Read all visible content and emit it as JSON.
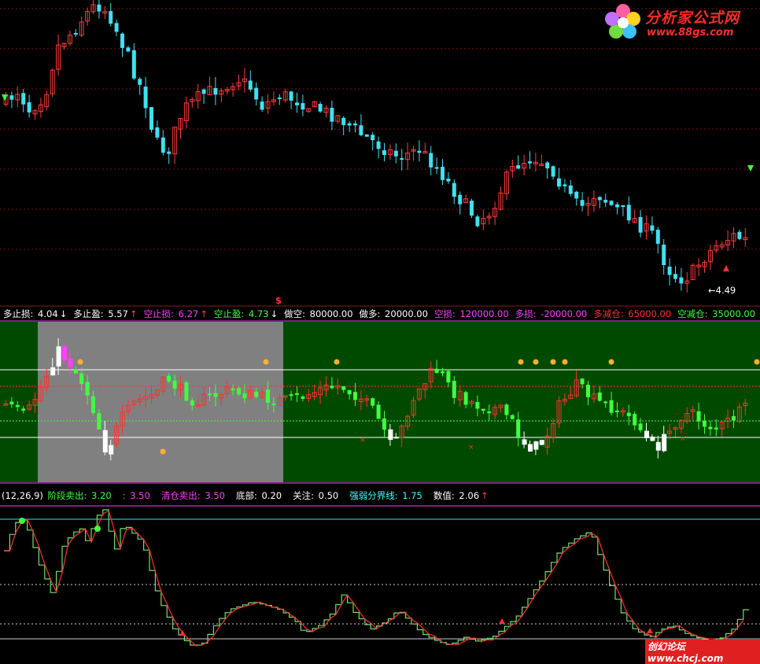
{
  "logo": {
    "title": "分析家公式网",
    "url": "www.88gs.com"
  },
  "price_panel": {
    "price_low_label": "4.49",
    "dollar_mark": "$",
    "colors": {
      "up": "#ff3b3b",
      "down": "#40e0f0",
      "grid": "#7a1010"
    }
  },
  "header1": {
    "items": [
      {
        "label": "多止损:",
        "value": "4.04",
        "color": "#ffffff",
        "arrow": "↓"
      },
      {
        "label": "多止盈:",
        "value": "5.57",
        "color": "#ffffff",
        "arrow": "↑"
      },
      {
        "label": "空止损:",
        "value": "6.27",
        "color": "#ff40ff",
        "arrow": "↑"
      },
      {
        "label": "空止盈:",
        "value": "4.73",
        "color": "#40ff40",
        "arrow": "↓"
      },
      {
        "label": "做空:",
        "value": "80000.00",
        "color": "#ffffff",
        "arrow": ""
      },
      {
        "label": "做多:",
        "value": "20000.00",
        "color": "#ffffff",
        "arrow": ""
      },
      {
        "label": "空损:",
        "value": "120000.00",
        "color": "#ff40ff",
        "arrow": ""
      },
      {
        "label": "多损:",
        "value": "-20000.00",
        "color": "#ff40ff",
        "arrow": ""
      },
      {
        "label": "多减仓:",
        "value": "65000.00",
        "color": "#ff3030",
        "arrow": ""
      },
      {
        "label": "空减仓:",
        "value": "35000.00",
        "color": "#40ff40",
        "arrow": ""
      }
    ]
  },
  "header2": {
    "params": "(12,26,9)",
    "items": [
      {
        "label": "阶段卖出:",
        "value": "3.20",
        "color": "#40ff40"
      },
      {
        "label": ":",
        "value": "3.50",
        "color": "#ff40ff"
      },
      {
        "label": "清仓卖出:",
        "value": "3.50",
        "color": "#ff40ff"
      },
      {
        "label": "底部:",
        "value": "0.20",
        "color": "#ffffff"
      },
      {
        "label": "关注:",
        "value": "0.50",
        "color": "#ffffff"
      },
      {
        "label": "强弱分界线:",
        "value": "1.75",
        "color": "#40ffff"
      },
      {
        "label": "数值:",
        "value": "2.06",
        "color": "#ffffff",
        "arrow": "↑"
      }
    ]
  },
  "mid_panel": {
    "bg_color": "#004a00",
    "highlight_color": "#808080"
  },
  "watermark": "创幻论坛 www.chcj.com"
}
